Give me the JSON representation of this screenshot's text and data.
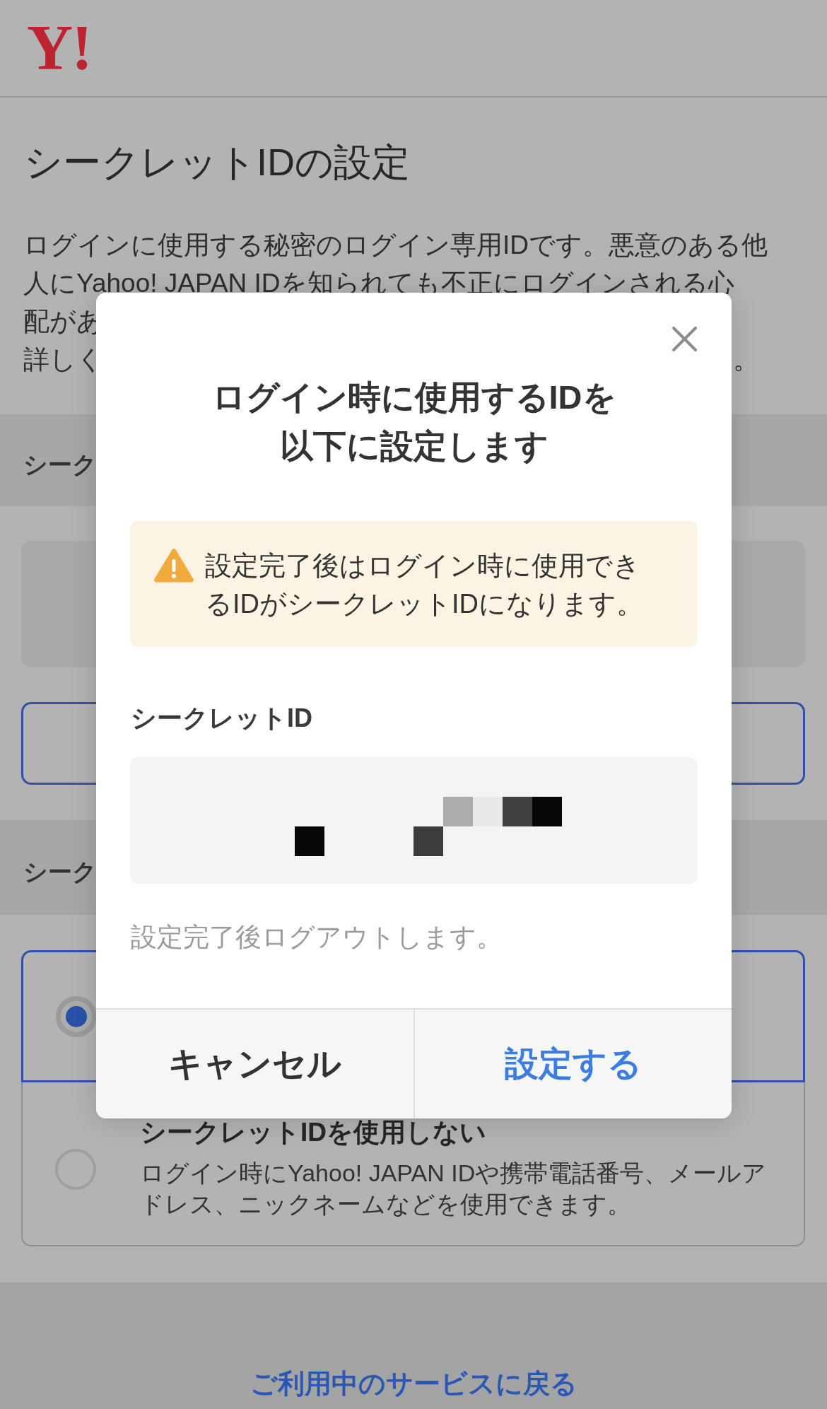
{
  "header": {
    "logo": "Y!"
  },
  "page_title": "シークレットIDの設定",
  "intro_lines": [
    {
      "text": "ログインに使用する秘密のログイン専用IDです。悪意のある他"
    },
    {
      "text": "人にYahoo! JAPAN IDを知られても不正にログインされる心"
    },
    {
      "text": "配があ"
    },
    {
      "text": "詳しく",
      "tail": "。"
    }
  ],
  "sections": [
    {
      "heading": "シーク",
      "kind": "info"
    },
    {
      "heading": "シーク",
      "kind": "choice",
      "options": [
        {
          "selected": true
        },
        {
          "title": "シークレットIDを使用しない",
          "description": "ログイン時にYahoo! JAPAN IDや携帯電話番号、メールアドレス、ニックネームなどを使用できます。",
          "selected": false
        }
      ]
    }
  ],
  "back_link": "ご利用中のサービスに戻る",
  "dialog": {
    "title": "ログイン時に使用するIDを以下に設定します",
    "warning": "設定完了後はログイン時に使用できるIDがシークレットIDになります。",
    "id_label": "シークレットID",
    "note": "設定完了後ログアウトします。",
    "buttons": [
      {
        "label": "キャンセル",
        "kind": "cancel"
      },
      {
        "label": "設定する",
        "kind": "confirm"
      }
    ]
  }
}
